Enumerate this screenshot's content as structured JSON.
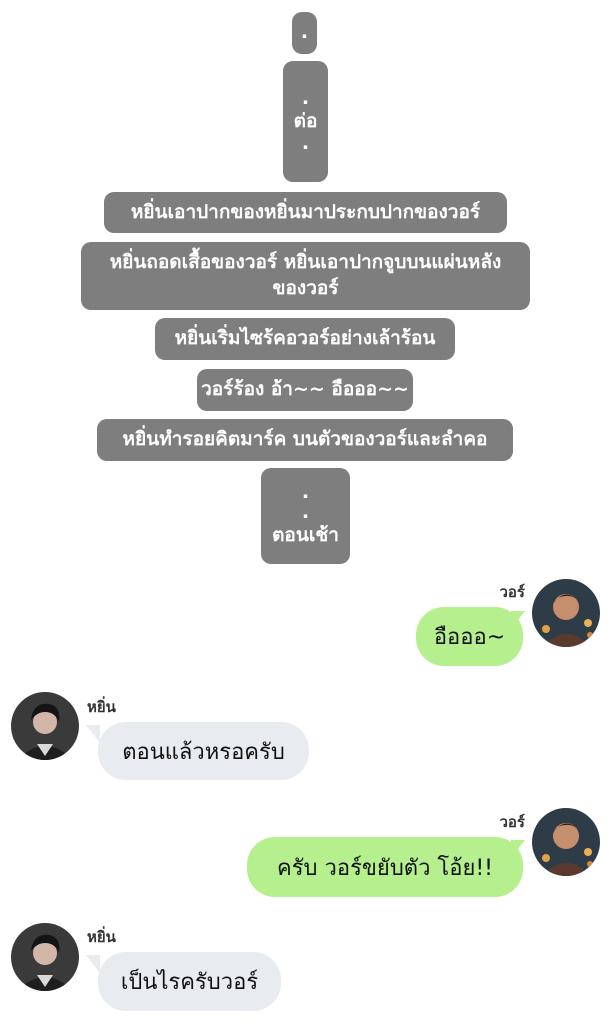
{
  "narration": {
    "n1": ".",
    "n2": {
      "dot": ".",
      "text": "ต่อ",
      "dot2": "."
    },
    "n3": "หยิ่นเอาปากของหยิ่นมาประกบปากของวอร์",
    "n4": {
      "line1": "หยิ่นถอดเสื้อของวอร์ หยิ่นเอาปากจูบบนแผ่นหลัง",
      "line2": "ของวอร์"
    },
    "n5": "หยิ่นเริ่มไซร้คอวอร์อย่างเล้าร้อน",
    "n6": "วอร์ร้อง อ้า~~ อือออ~~",
    "n7": "หยิ่นทำรอยคิตมาร์ค บนตัวของวอร์และลำคอ",
    "n8": {
      "dot1": ".",
      "dot2": ".",
      "text": "ตอนเช้า"
    }
  },
  "messages": [
    {
      "sender": "วอร์",
      "text": "อือออ~",
      "side": "right",
      "avatar_icon": "user-avatar-icon"
    },
    {
      "sender": "หยิ่น",
      "text": "ตอนแล้วหรอครับ",
      "side": "left",
      "avatar_icon": "user-avatar-icon"
    },
    {
      "sender": "วอร์",
      "text": "ครับ วอร์ขยับตัว โอ้ย!!",
      "side": "right",
      "avatar_icon": "user-avatar-icon"
    },
    {
      "sender": "หยิ่น",
      "text": "เป็นไรครับวอร์",
      "side": "left",
      "avatar_icon": "user-avatar-icon"
    }
  ],
  "colors": {
    "narration_bg": "#7e7e7e",
    "bubble_green": "#b6f08e",
    "bubble_gray": "#e8ebef"
  }
}
